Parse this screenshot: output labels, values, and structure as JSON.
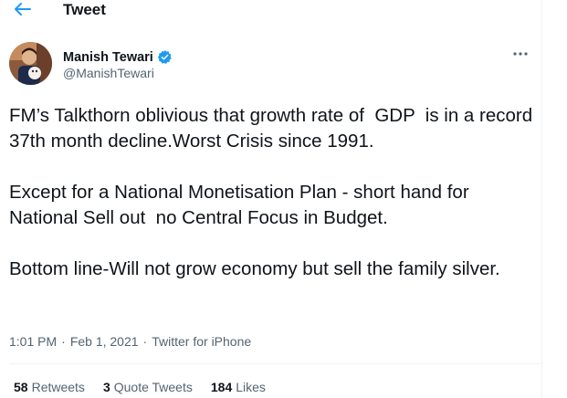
{
  "header": {
    "title": "Tweet",
    "back_icon": "arrow-left-icon"
  },
  "author": {
    "name": "Manish Tewari",
    "handle": "@ManishTewari",
    "verified": true
  },
  "tweet": {
    "paragraphs": [
      "FM’s Talkthorn oblivious that growth rate of  GDP  is in a record 37th month decline.Worst Crisis since 1991.",
      "Except for a National Monetisation Plan - short hand for National Sell out  no Central Focus in Budget.",
      "Bottom line-Will not grow economy but sell the family silver."
    ]
  },
  "meta": {
    "time": "1:01 PM",
    "separator1": "·",
    "date": "Feb 1, 2021",
    "separator2": "·",
    "source": "Twitter for iPhone"
  },
  "stats": {
    "retweets": {
      "count": "58",
      "label": "Retweets"
    },
    "quotes": {
      "count": "3",
      "label": "Quote Tweets"
    },
    "likes": {
      "count": "184",
      "label": "Likes"
    }
  },
  "colors": {
    "accent": "#1d9bf0",
    "text": "#0f1419",
    "muted": "#536471",
    "divider": "#eff3f4"
  }
}
